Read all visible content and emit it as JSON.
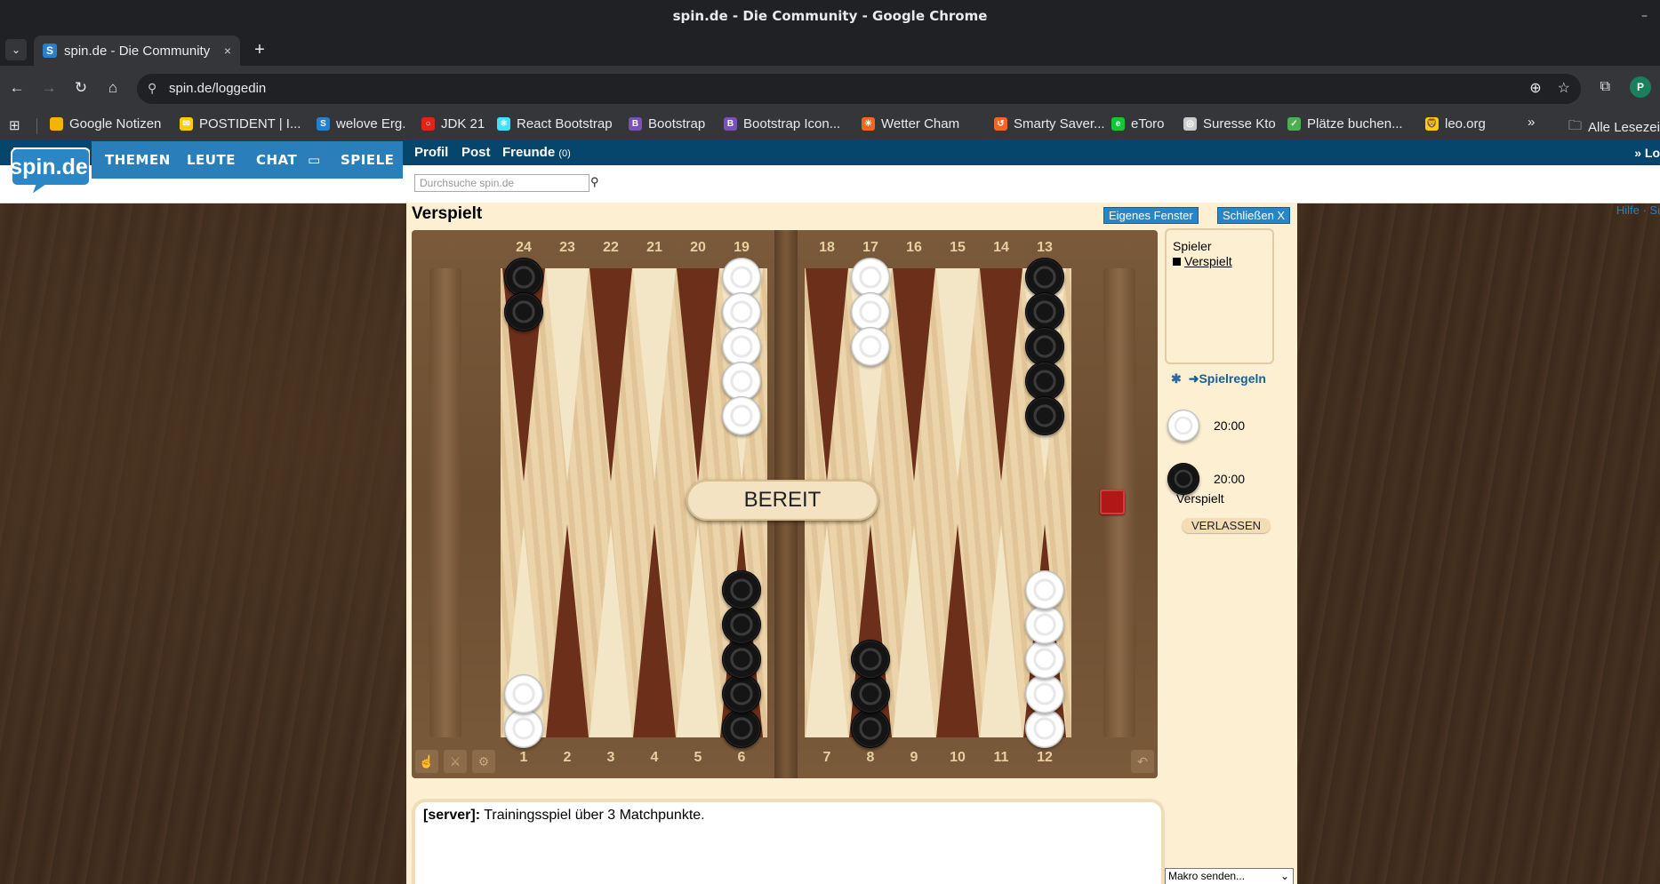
{
  "window": {
    "title": "spin.de - Die Community - Google Chrome",
    "minimize_glyph": "–",
    "tab_list_glyph": "⌄"
  },
  "tabs": [
    {
      "title": "spin.de - Die Community",
      "favicon_letter": "S",
      "close_glyph": "×"
    }
  ],
  "new_tab_glyph": "+",
  "toolbar": {
    "back_glyph": "←",
    "forward_glyph": "→",
    "reload_glyph": "↻",
    "home_glyph": "⌂",
    "site_info_glyph": "⚲",
    "url": "spin.de/loggedin",
    "zoom_glyph": "⊕",
    "star_glyph": "☆",
    "extensions_glyph": "⧉",
    "profile_initial": "P"
  },
  "bookmarks": {
    "apps_glyph": "⊞",
    "items": [
      {
        "label": "Google Notizen",
        "color": "#f4b400",
        "letter": ""
      },
      {
        "label": "POSTIDENT | I...",
        "color": "#ffcc00",
        "letter": "✉"
      },
      {
        "label": "welove Erg.",
        "color": "#2a80c8",
        "letter": "S"
      },
      {
        "label": "JDK 21",
        "color": "#e2231a",
        "letter": "○"
      },
      {
        "label": "React Bootstrap",
        "color": "#41e0fd",
        "letter": "⚛"
      },
      {
        "label": "Bootstrap",
        "color": "#7952b3",
        "letter": "B"
      },
      {
        "label": "Bootstrap Icon...",
        "color": "#7952b3",
        "letter": "B"
      },
      {
        "label": "Wetter Cham",
        "color": "#f26522",
        "letter": "☀"
      },
      {
        "label": "Smarty Saver...",
        "color": "#f26522",
        "letter": "↺"
      },
      {
        "label": "eToro",
        "color": "#13c636",
        "letter": "e"
      },
      {
        "label": "Suresse Kto",
        "color": "#cccccc",
        "letter": "◎"
      },
      {
        "label": "Plätze buchen...",
        "color": "#4caf50",
        "letter": "✓"
      },
      {
        "label": "leo.org",
        "color": "#ffcc00",
        "letter": "🦁"
      }
    ],
    "overflow_glyph": "»",
    "all_bookmarks": "Alle Lesezeichen"
  },
  "site": {
    "logo_text": "spin.de",
    "nav": [
      "THEMEN",
      "LEUTE",
      "CHAT",
      "SPIELE"
    ],
    "chat_icon": "▭",
    "subnav": {
      "profil": "Profil",
      "post": "Post",
      "freunde": "Freunde",
      "freunde_count": "(0)"
    },
    "search_placeholder": "Durchsuche spin.de",
    "search_icon": "⚲",
    "right_top": "» Lo",
    "right_links": "Hilfe · Si"
  },
  "game": {
    "title": "Verspielt",
    "own_window_label": "Eigenes Fenster",
    "close_label": "Schließen X",
    "top_numbers_left": [
      "24",
      "23",
      "22",
      "21",
      "20",
      "19"
    ],
    "top_numbers_right": [
      "18",
      "17",
      "16",
      "15",
      "14",
      "13"
    ],
    "bottom_numbers_left": [
      "1",
      "2",
      "3",
      "4",
      "5",
      "6"
    ],
    "bottom_numbers_right": [
      "7",
      "8",
      "9",
      "10",
      "11",
      "12"
    ],
    "status_text": "BEREIT",
    "points": {
      "24": {
        "color": "b",
        "count": 2
      },
      "19": {
        "color": "w",
        "count": 5
      },
      "17": {
        "color": "w",
        "count": 3
      },
      "13": {
        "color": "b",
        "count": 5
      },
      "1": {
        "color": "w",
        "count": 2
      },
      "6": {
        "color": "b",
        "count": 5
      },
      "8": {
        "color": "b",
        "count": 3
      },
      "12": {
        "color": "w",
        "count": 5
      }
    },
    "sidebar": {
      "players_label": "Spieler",
      "player_name": "Verspielt",
      "rules_icon": "✱",
      "rules_label": "➜Spielregeln",
      "white_timer": "20:00",
      "black_timer": "20:00",
      "black_player": "Verspielt",
      "leave_label": "VERLASSEN"
    },
    "tool_icons": [
      "☝",
      "⚔",
      "⚙"
    ],
    "undo_icon": "↶",
    "chat": {
      "sender": "[server]:",
      "message": "Trainingsspiel über 3 Matchpunkte."
    },
    "macro_label": "Makro senden..."
  }
}
